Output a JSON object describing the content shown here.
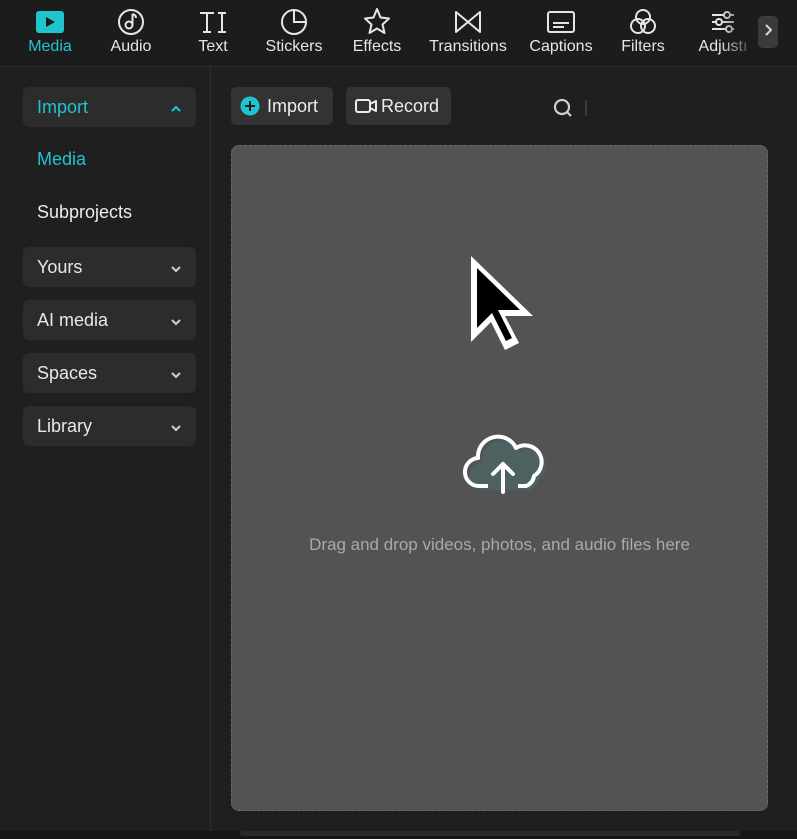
{
  "toolbar": {
    "items": [
      {
        "label": "Media",
        "icon": "media-icon"
      },
      {
        "label": "Audio",
        "icon": "audio-icon"
      },
      {
        "label": "Text",
        "icon": "text-icon"
      },
      {
        "label": "Stickers",
        "icon": "stickers-icon"
      },
      {
        "label": "Effects",
        "icon": "effects-icon"
      },
      {
        "label": "Transitions",
        "icon": "transitions-icon"
      },
      {
        "label": "Captions",
        "icon": "captions-icon"
      },
      {
        "label": "Filters",
        "icon": "filters-icon"
      },
      {
        "label": "Adjustı",
        "icon": "adjust-icon"
      }
    ],
    "active": "Media",
    "more_icon": "chevron-right-icon"
  },
  "sidebar": {
    "import_label": "Import",
    "sub_items": [
      "Media",
      "Subprojects"
    ],
    "active_sub": "Media",
    "groups": [
      "Yours",
      "AI media",
      "Spaces",
      "Library"
    ]
  },
  "main": {
    "import_button": "Import",
    "record_button": "Record",
    "search_icon": "search-icon",
    "dropzone_text": "Drag and drop videos, photos, and audio files here",
    "dropzone_icon": "cloud-upload-icon"
  },
  "colors": {
    "accent": "#20c4cf",
    "background": "#1f1f1f",
    "dropzone": "#535353"
  }
}
